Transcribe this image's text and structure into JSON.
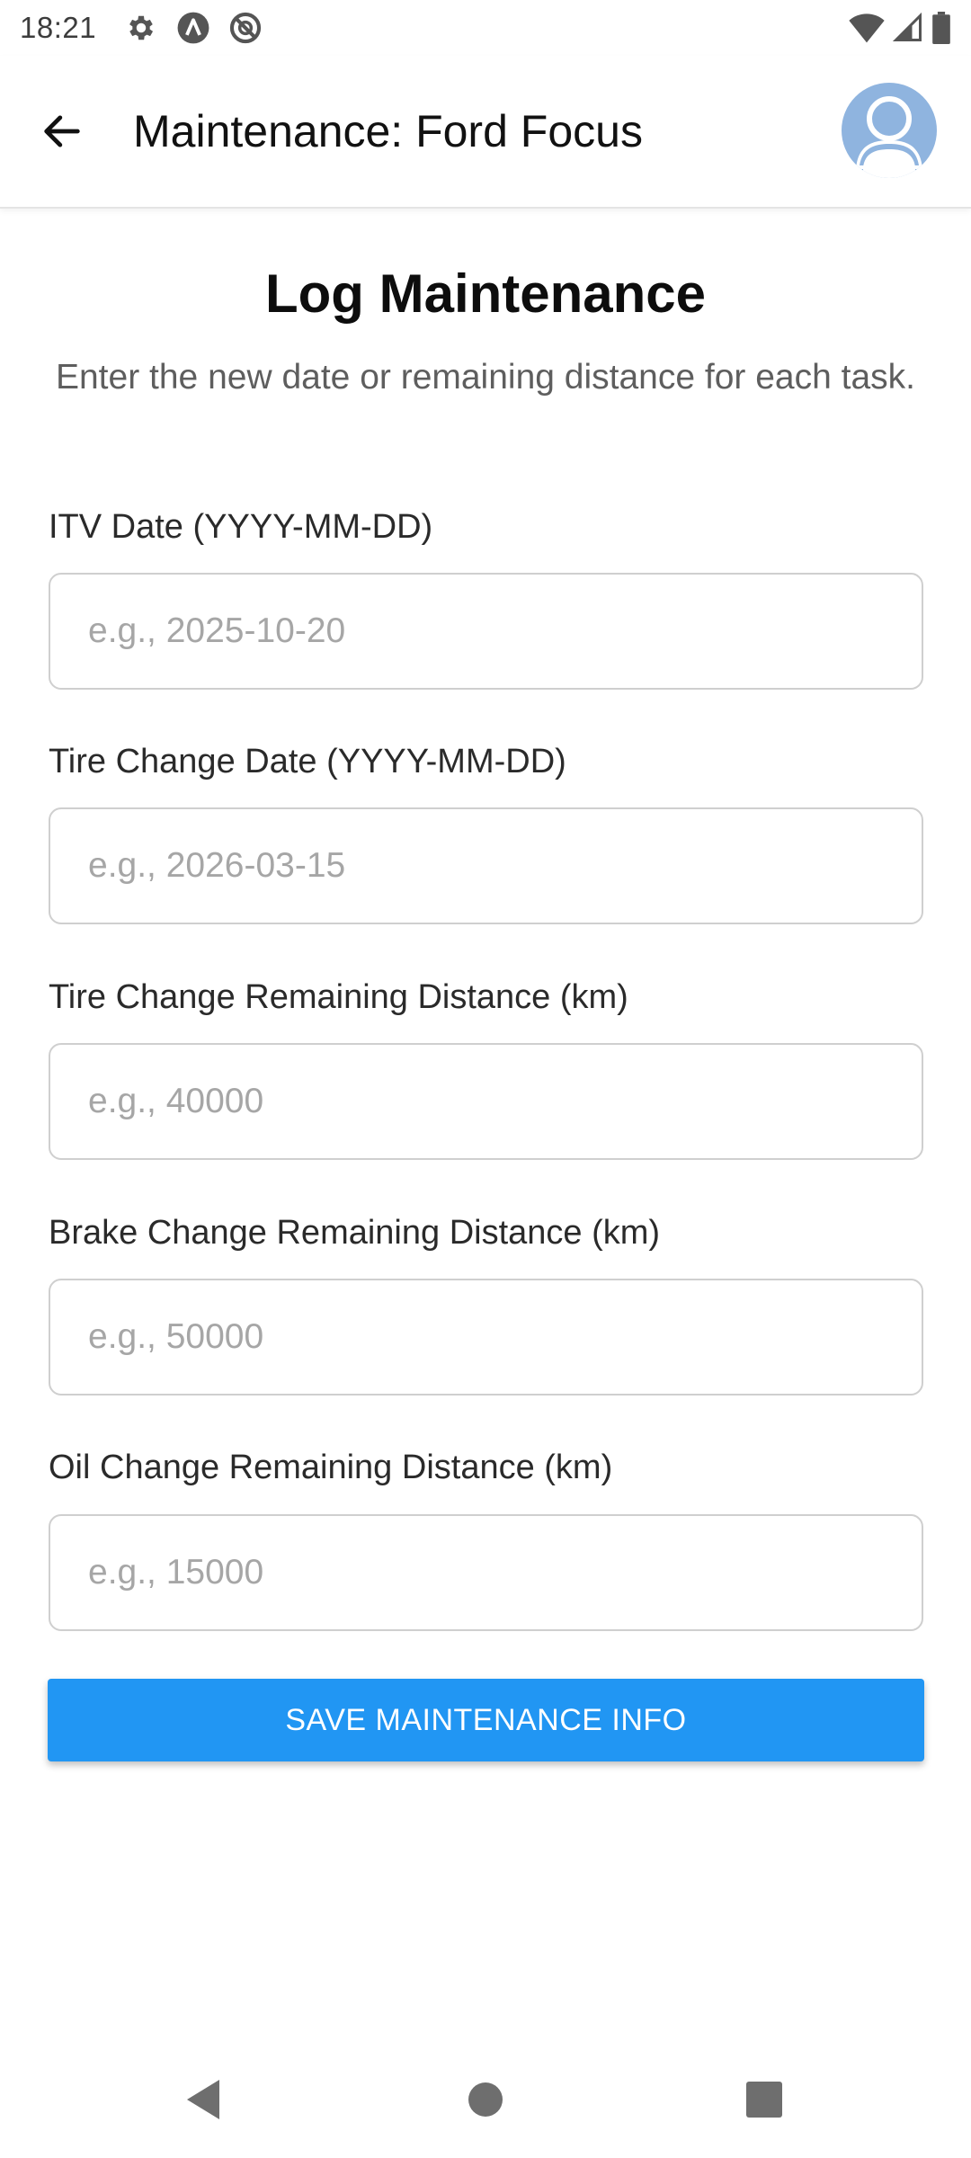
{
  "status_bar": {
    "time": "18:21",
    "icons": [
      "gear-icon",
      "a-icon",
      "sync-off-icon",
      "wifi-icon",
      "signal-icon",
      "battery-icon"
    ]
  },
  "app_bar": {
    "title": "Maintenance: Ford Focus",
    "back_icon": "arrow-left-icon",
    "avatar_icon": "user-avatar-icon"
  },
  "form": {
    "title": "Log Maintenance",
    "subtitle": "Enter the new date or remaining distance for each task.",
    "fields": [
      {
        "label": "ITV Date (YYYY-MM-DD)",
        "placeholder": "e.g., 2025-10-20",
        "value": ""
      },
      {
        "label": "Tire Change Date (YYYY-MM-DD)",
        "placeholder": "e.g., 2026-03-15",
        "value": ""
      },
      {
        "label": "Tire Change Remaining Distance (km)",
        "placeholder": "e.g., 40000",
        "value": ""
      },
      {
        "label": "Brake Change Remaining Distance (km)",
        "placeholder": "e.g., 50000",
        "value": ""
      },
      {
        "label": "Oil Change Remaining Distance (km)",
        "placeholder": "e.g., 15000",
        "value": ""
      }
    ],
    "save_label": "SAVE MAINTENANCE INFO"
  },
  "colors": {
    "accent": "#2196f3",
    "avatar_bg": "#8fb4df"
  },
  "nav_bar": {
    "icons": [
      "back-triangle-icon",
      "home-circle-icon",
      "recents-square-icon"
    ]
  }
}
